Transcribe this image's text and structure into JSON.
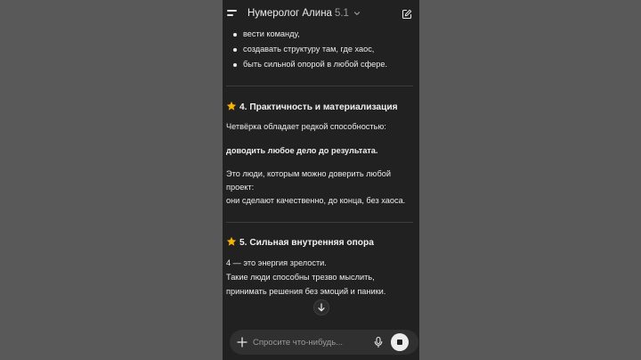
{
  "app": {
    "title": "Нумеролог Алина",
    "version": "5.1"
  },
  "message": {
    "bullets": [
      "вести команду,",
      "создавать структуру там, где хаос,",
      "быть сильной опорой в любой сфере."
    ],
    "sections": [
      {
        "heading": "4. Практичность и материализация",
        "intro": "Четвёрка обладает редкой способностью:",
        "highlight": "доводить любое дело до результата.",
        "body": [
          "Это люди, которым можно доверить любой",
          "проект:",
          "они сделают качественно, до конца, без хаоса."
        ]
      },
      {
        "heading": "5. Сильная внутренняя опора",
        "body": [
          "4 — это энергия зрелости.",
          "Такие люди способны трезво мыслить,",
          "принимать решения без эмоций и паники."
        ]
      }
    ]
  },
  "composer": {
    "placeholder": "Спросите что-нибудь..."
  },
  "colors": {
    "page_background": "#595959",
    "chat_background": "#212121",
    "text": "#ececec",
    "composer_background": "#303030",
    "star": "#f5b400"
  },
  "icons": [
    "hamburger-menu-icon",
    "chevron-down-icon",
    "new-chat-icon",
    "star-icon",
    "arrow-down-icon",
    "plus-icon",
    "microphone-icon",
    "stop-icon"
  ]
}
